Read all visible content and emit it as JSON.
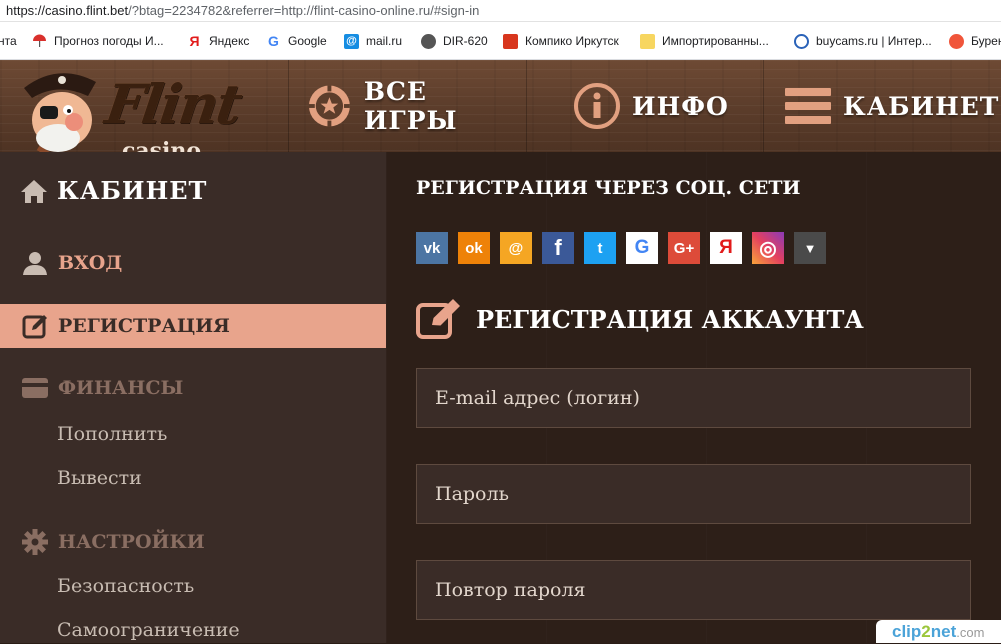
{
  "browser": {
    "url_host": "https://casino.flint.bet",
    "url_rest": "/?btag=2234782&referrer=http://flint-casino-online.ru/#sign-in",
    "bookmarks": [
      {
        "label": "нта",
        "icon": "none"
      },
      {
        "label": "Прогноз погоды И...",
        "icon": "umbrella-icon"
      },
      {
        "label": "Яндекс",
        "icon": "yandex-icon"
      },
      {
        "label": "Google",
        "icon": "google-icon"
      },
      {
        "label": "mail.ru",
        "icon": "mail-at-icon"
      },
      {
        "label": "DIR-620",
        "icon": "globe-icon"
      },
      {
        "label": "Компико Иркутск",
        "icon": "computer-icon"
      },
      {
        "label": "Импортированны...",
        "icon": "folder-icon"
      },
      {
        "label": "buycams.ru | Интер...",
        "icon": "site-icon"
      },
      {
        "label": "Бурен",
        "icon": "circle-icon"
      }
    ]
  },
  "logo": {
    "brand": "Flint",
    "sub": "casino"
  },
  "nav": {
    "all_games": "ВСЕ ИГРЫ",
    "info": "ИНФО",
    "cabinet": "КАБИНЕТ"
  },
  "sidebar": {
    "title": "КАБИНЕТ",
    "login": "ВХОД",
    "register": "РЕГИСТРАЦИЯ",
    "finances": "ФИНАНСЫ",
    "deposit": "Пополнить",
    "withdraw": "Вывести",
    "settings": "НАСТРОЙКИ",
    "security": "Безопасность",
    "self_limit": "Самоограничение"
  },
  "main": {
    "social_title": "РЕГИСТРАЦИЯ ЧЕРЕЗ СОЦ. СЕТИ",
    "social": [
      {
        "name": "vk",
        "glyph": "vk",
        "color": "#4c75a3"
      },
      {
        "name": "odnoklassniki",
        "glyph": "ok",
        "color": "#ee8208"
      },
      {
        "name": "mailru",
        "glyph": "@",
        "color": "#f5a623"
      },
      {
        "name": "facebook",
        "glyph": "f",
        "color": "#3b5998"
      },
      {
        "name": "twitter",
        "glyph": "t",
        "color": "#1da1f2"
      },
      {
        "name": "google",
        "glyph": "G",
        "color": "#ffffff"
      },
      {
        "name": "googleplus",
        "glyph": "G+",
        "color": "#dd4b39"
      },
      {
        "name": "yandex",
        "glyph": "Я",
        "color": "#ffffff"
      },
      {
        "name": "instagram",
        "glyph": "◎",
        "color": "#c13584"
      },
      {
        "name": "more",
        "glyph": "▼",
        "color": "#4a4a4a"
      }
    ],
    "reg_title": "РЕГИСТРАЦИЯ АККАУНТА",
    "email_placeholder": "E-mail адрес (логин)",
    "password_placeholder": "Пароль",
    "password_repeat_placeholder": "Повтор пароля"
  },
  "watermark": {
    "a": "clip",
    "b": "2",
    "c": "net",
    "d": ".com"
  },
  "colors": {
    "accent": "#e8a48c",
    "sidebar_bg": "#3a2c27",
    "main_bg": "#2d1f18",
    "section_muted": "#8a6e62"
  }
}
